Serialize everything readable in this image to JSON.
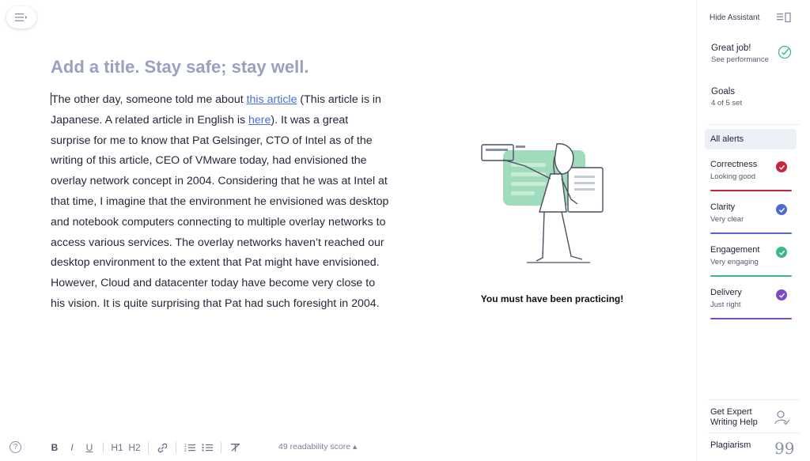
{
  "editor": {
    "title": "Add a title. Stay safe; stay well.",
    "body_parts": {
      "p1": "The other day, someone told me about ",
      "link1": "this article",
      "p2": " (This article is in Japanese. A related article in English is ",
      "link2": "here",
      "p3": "). It was a great surprise for me to know that Pat Gelsinger, CTO of Intel as of the writing of this article, CEO of VMware today, had envisioned the overlay network concept in 2004. Considering that he was at Intel at that time, I imagine that the environment he envisioned was desktop and notebook computers connecting to multiple overlay networks to access various services. The overlay networks haven’t reached our desktop environment to the extent that Pat might have envisioned. However, Cloud and datacenter today have become very close to his vision. It is quite surprising that Pat had such foresight in 2004."
    }
  },
  "feedback": {
    "message": "You must have been practicing!"
  },
  "toolbar": {
    "help": "?",
    "bold": "B",
    "italic": "I",
    "underline": "U",
    "h1": "H1",
    "h2": "H2",
    "link": "🔗",
    "ordered_list": "1☰",
    "bullet_list": "•☰",
    "clear_format": "T̶",
    "readability": "49 readability score ▴"
  },
  "sidebar": {
    "hide_assistant": "Hide Assistant",
    "great_job": "Great job!",
    "see_performance": "See performance",
    "goals": "Goals",
    "goals_sub": "4 of 5 set",
    "all_alerts": "All alerts",
    "categories": [
      {
        "name": "Correctness",
        "sub": "Looking good",
        "color": "#c8243f"
      },
      {
        "name": "Clarity",
        "sub": "Very clear",
        "color": "#4f6bd0"
      },
      {
        "name": "Engagement",
        "sub": "Very engaging",
        "color": "#3fb887"
      },
      {
        "name": "Delivery",
        "sub": "Just right",
        "color": "#7a4bc5"
      }
    ],
    "expert_line1": "Get Expert",
    "expert_line2": "Writing Help",
    "plagiarism": "Plagiarism",
    "plagiarism_icon": "99"
  },
  "colors": {
    "accent": "#15c39a",
    "link": "#4a6fd6",
    "title": "#9aa0bf"
  },
  "icons": [
    "menu-icon",
    "hide-assistant-icon",
    "check-icon",
    "expert-icon",
    "quote-icon"
  ]
}
